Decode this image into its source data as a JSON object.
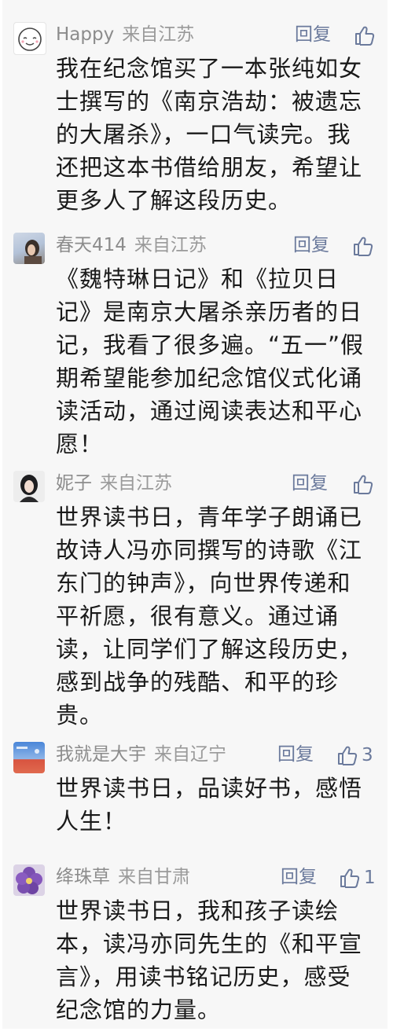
{
  "comments": [
    {
      "user": "Happy",
      "location": "来自江苏",
      "reply_label": "回复",
      "like_count": "",
      "avatar_icon": "smiley-face-avatar",
      "lines": [
        "我在纪念馆买了一本张纯如女",
        "士撰写的《南京浩劫：被遗忘",
        "的大屠杀》，一口气读完。我",
        "还把这本书借给朋友，希望让",
        "更多人了解这段历史。"
      ]
    },
    {
      "user": "春天414",
      "location": "来自江苏",
      "reply_label": "回复",
      "like_count": "",
      "avatar_icon": "photo-avatar",
      "lines": [
        "《魏特琳日记》和《拉贝日",
        "记》是南京大屠杀亲历者的日",
        "记，我看了很多遍。“五一”假",
        "期希望能参加纪念馆仪式化诵",
        "读活动，通过阅读表达和平心",
        "愿！"
      ]
    },
    {
      "user": "妮子",
      "location": "来自江苏",
      "reply_label": "回复",
      "like_count": "",
      "avatar_icon": "portrait-avatar",
      "lines": [
        "世界读书日，青年学子朗诵已",
        "故诗人冯亦同撰写的诗歌《江",
        "东门的钟声》，向世界传递和",
        "平祈愿，很有意义。通过诵",
        "读，让同学们了解这段历史，",
        "感到战争的残酷、和平的珍",
        "贵。"
      ]
    },
    {
      "user": "我就是大宇",
      "location": "来自辽宁",
      "reply_label": "回复",
      "like_count": "3",
      "avatar_icon": "scenery-avatar",
      "lines": [
        "世界读书日，品读好书，感悟",
        "人生！"
      ]
    },
    {
      "user": "绛珠草",
      "location": "来自甘肃",
      "reply_label": "回复",
      "like_count": "1",
      "avatar_icon": "flower-avatar",
      "lines": [
        "世界读书日，我和孩子读绘",
        "本，读冯亦同先生的《和平宣",
        "言》，用读书铭记历史，感受",
        "纪念馆的力量。"
      ]
    }
  ]
}
